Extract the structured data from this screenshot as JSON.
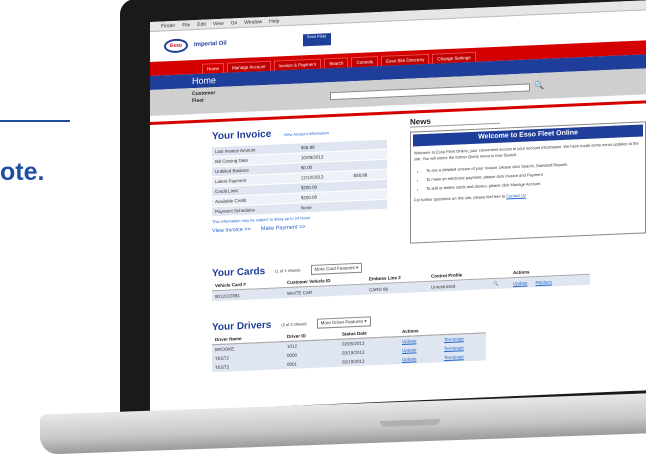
{
  "fragment": {
    "text": "ote."
  },
  "mac_menu": [
    "Finder",
    "File",
    "Edit",
    "View",
    "Go",
    "Window",
    "Help"
  ],
  "brand": {
    "logo": "Esso",
    "name": "Imperial Oil",
    "badge": "Esso Fleet"
  },
  "nav": [
    "Home",
    "Manage Account",
    "Invoice & Payment",
    "Search",
    "Controls",
    "Esso Site Directory",
    "Change Settings"
  ],
  "page_title": "Home",
  "search": {
    "label_line1": "Customer",
    "label_line2": "Fleet",
    "button_icon": "search-icon"
  },
  "invoice": {
    "title": "Your Invoice",
    "link": "View Account Information",
    "rows": [
      {
        "label": "Last Invoice Amount",
        "value": "$58.88",
        "extra": ""
      },
      {
        "label": "Bill Closing Date",
        "value": "10/08/2013",
        "extra": ""
      },
      {
        "label": "Unbilled Balance",
        "value": "$0.00",
        "extra": ""
      },
      {
        "label": "Latest Payment",
        "value": "12/12/2013",
        "extra": "$58.88"
      },
      {
        "label": "Credit Limit",
        "value": "$200.00",
        "extra": ""
      },
      {
        "label": "Available Credit",
        "value": "$200.00",
        "extra": ""
      },
      {
        "label": "Payment Schedules",
        "value": "None",
        "extra": ""
      }
    ],
    "note": "This information may be subject to delay up to 24 hours",
    "view_link": "View Invoice >>",
    "pay_link": "Make Payment >>"
  },
  "news": {
    "title": "News",
    "headline": "Welcome to Esso Fleet Online",
    "intro": "Welcome to Esso Fleet Online, your convenient access to your account information. We have made some minor updates to the site. You will notice the former Query menu is now Search.",
    "bullets": [
      "To see a detailed version of your invoice, please click Search, Standard Reports",
      "To make an electronic payment, please click Invoice and Payment",
      "To add or delete cards and drivers, please click Manage Account"
    ],
    "footer": "For further questions on this site, please feel free to",
    "footer_link": "Contact Us"
  },
  "cards": {
    "title": "Your Cards",
    "count": "(1 of 1 shown)",
    "select": "More Card Features",
    "columns": [
      "Vehicle Card #",
      "Customer Vehicle ID",
      "Emboss Line 2",
      "Control Profile",
      "",
      "Actions"
    ],
    "rows": [
      {
        "card": "8012/2/2081",
        "vehicle_id": "WHITE CAR",
        "emboss": "CARD 99",
        "profile": "Unrestricted",
        "a1": "Update",
        "a2": "Replace"
      }
    ]
  },
  "drivers": {
    "title": "Your Drivers",
    "count": "(3 of 3 shown)",
    "select": "More Driver Features",
    "columns": [
      "Driver Name",
      "Driver ID",
      "Status Date",
      "Actions",
      ""
    ],
    "rows": [
      {
        "name": "BROOKE",
        "id": "1012",
        "date": "02/05/2013",
        "a1": "Update",
        "a2": "Terminate"
      },
      {
        "name": "TEST2",
        "id": "0000",
        "date": "03/19/2013",
        "a1": "Update",
        "a2": "Terminate"
      },
      {
        "name": "TEST3",
        "id": "0001",
        "date": "03/19/2013",
        "a1": "Update",
        "a2": "Terminate"
      }
    ]
  }
}
